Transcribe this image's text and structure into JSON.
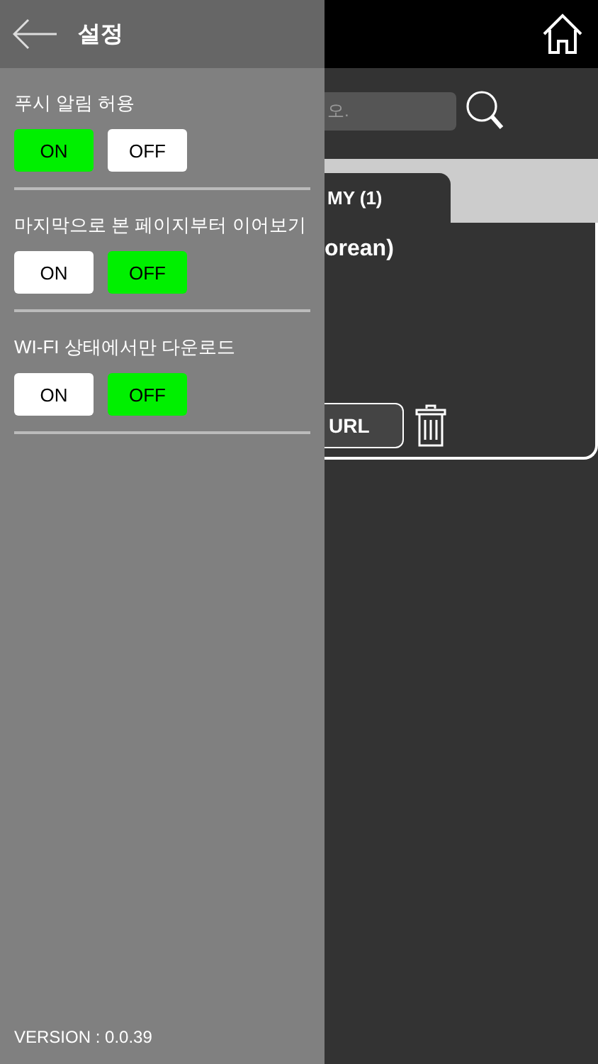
{
  "background_screen": {
    "search": {
      "placeholder": "오."
    },
    "tabs": [
      {
        "label": "MY (1)",
        "selected": true
      }
    ],
    "card": {
      "title": "orean)",
      "button": "URL"
    }
  },
  "drawer": {
    "title": "설정",
    "settings": [
      {
        "label": "푸시 알림 허용",
        "on": true,
        "on_label": "ON",
        "off_label": "OFF"
      },
      {
        "label": "마지막으로 본 페이지부터 이어보기",
        "on": false,
        "on_label": "ON",
        "off_label": "OFF"
      },
      {
        "label": "WI-FI 상태에서만 다운로드",
        "on": false,
        "on_label": "ON",
        "off_label": "OFF"
      }
    ],
    "version": "VERSION : 0.0.39"
  }
}
